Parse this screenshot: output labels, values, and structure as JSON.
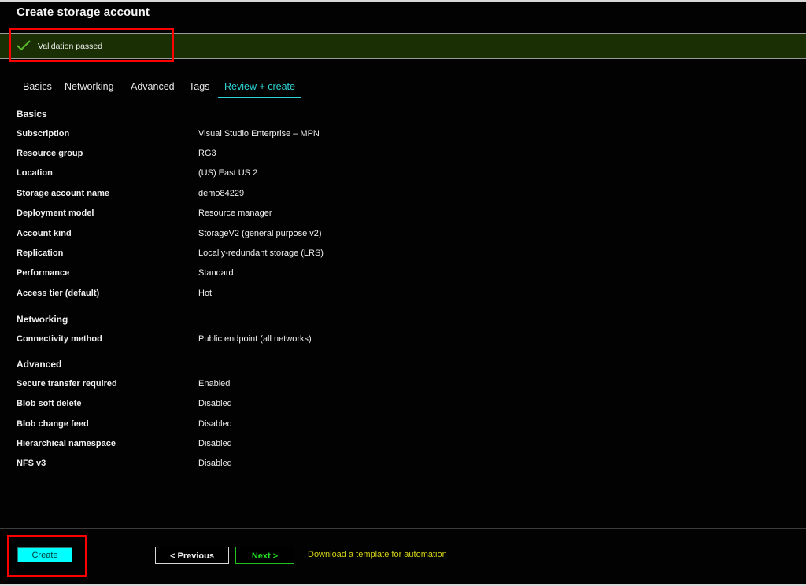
{
  "window": {
    "title": "Create storage account"
  },
  "banner": {
    "icon": "checkmark-icon",
    "message": "Validation passed",
    "color": "#1b2f05"
  },
  "tabs": [
    {
      "label": "Basics",
      "active": false
    },
    {
      "label": "Networking",
      "active": false
    },
    {
      "label": "Advanced",
      "active": false
    },
    {
      "label": "Tags",
      "active": false
    },
    {
      "label": "Review + create",
      "active": true
    }
  ],
  "sections": {
    "basics": {
      "title": "Basics",
      "rows": [
        {
          "label": "Subscription",
          "value": "Visual Studio Enterprise – MPN"
        },
        {
          "label": "Resource group",
          "value": "RG3"
        },
        {
          "label": "Location",
          "value": "(US) East US 2"
        },
        {
          "label": "Storage account name",
          "value": "demo84229"
        },
        {
          "label": "Deployment model",
          "value": "Resource manager"
        },
        {
          "label": "Account kind",
          "value": "StorageV2 (general purpose v2)"
        },
        {
          "label": "Replication",
          "value": "Locally-redundant storage (LRS)"
        },
        {
          "label": "Performance",
          "value": "Standard"
        },
        {
          "label": "Access tier (default)",
          "value": "Hot"
        }
      ]
    },
    "networking": {
      "title": "Networking",
      "rows": [
        {
          "label": "Connectivity method",
          "value": "Public endpoint (all networks)"
        }
      ]
    },
    "advanced": {
      "title": "Advanced",
      "rows": [
        {
          "label": "Secure transfer required",
          "value": "Enabled"
        },
        {
          "label": "Blob soft delete",
          "value": "Disabled"
        },
        {
          "label": "Blob change feed",
          "value": "Disabled"
        },
        {
          "label": "Hierarchical namespace",
          "value": "Disabled"
        },
        {
          "label": "NFS v3",
          "value": "Disabled"
        }
      ]
    }
  },
  "footer": {
    "create_label": "Create",
    "previous_label": "< Previous",
    "next_label": "Next >",
    "template_link": "Download a template for automation"
  },
  "colors": {
    "accent": "#2fd4d4",
    "create_button": "#00ffff",
    "next_button": "#22e022",
    "link": "#d6d616",
    "highlight_box": "#ff0000",
    "check": "#5cb82e"
  }
}
